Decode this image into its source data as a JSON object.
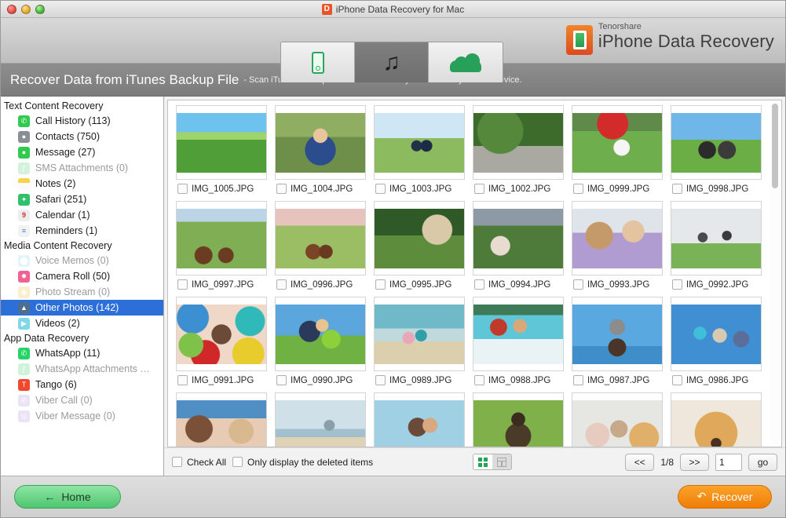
{
  "window": {
    "title": "iPhone Data Recovery for Mac",
    "logo_letter": "D",
    "controls": {
      "close": "close",
      "minimize": "minimize",
      "zoom": "zoom"
    }
  },
  "toolbar": {
    "tabs": [
      {
        "name": "recover-from-ios-device",
        "icon": "iphone-icon",
        "active": false
      },
      {
        "name": "recover-from-itunes-backup",
        "icon": "music-note-icon",
        "active": true
      },
      {
        "name": "recover-from-icloud-backup",
        "icon": "cloud-icon",
        "active": false
      }
    ],
    "brand": {
      "company": "Tenorshare",
      "product": "iPhone Data Recovery",
      "mark": "tenorshare-d-logo"
    }
  },
  "banner": {
    "title": "Recover Data from iTunes Backup File",
    "subtitle": "- Scan iTunes backup file to extract files if you have lost your iOS device."
  },
  "sidebar": {
    "groups": [
      {
        "title": "Text Content Recovery",
        "items": [
          {
            "label": "Call History (113)",
            "icon": "phone-icon",
            "color": "#31c94e",
            "dim": false,
            "selected": false
          },
          {
            "label": "Contacts (750)",
            "icon": "contacts-icon",
            "color": "#8a8f96",
            "dim": false,
            "selected": false
          },
          {
            "label": "Message (27)",
            "icon": "message-icon",
            "color": "#31c94e",
            "dim": false,
            "selected": false
          },
          {
            "label": "SMS Attachments (0)",
            "icon": "paperclip-icon",
            "color": "#9be0ac",
            "dim": true,
            "selected": false
          },
          {
            "label": "Notes (2)",
            "icon": "notes-icon",
            "color": "#f6d34b",
            "dim": false,
            "selected": false
          },
          {
            "label": "Safari (251)",
            "icon": "safari-icon",
            "color": "#2fc06a",
            "dim": false,
            "selected": false
          },
          {
            "label": "Calendar (1)",
            "icon": "calendar-icon",
            "color": "#ededed",
            "dim": false,
            "selected": false
          },
          {
            "label": "Reminders (1)",
            "icon": "reminders-icon",
            "color": "#f2f2f2",
            "dim": false,
            "selected": false
          }
        ]
      },
      {
        "title": "Media Content Recovery",
        "items": [
          {
            "label": "Voice Memos (0)",
            "icon": "microphone-icon",
            "color": "#bfe7f5",
            "dim": true,
            "selected": false
          },
          {
            "label": "Camera Roll (50)",
            "icon": "photos-icon",
            "color": "#f06292",
            "dim": false,
            "selected": false
          },
          {
            "label": "Photo Stream (0)",
            "icon": "photostream-icon",
            "color": "#f7d78a",
            "dim": true,
            "selected": false
          },
          {
            "label": "Other Photos (142)",
            "icon": "otherphotos-icon",
            "color": "#4e6e8e",
            "dim": false,
            "selected": true
          },
          {
            "label": "Videos (2)",
            "icon": "video-icon",
            "color": "#7fd8e8",
            "dim": false,
            "selected": false
          }
        ]
      },
      {
        "title": "App Data Recovery",
        "items": [
          {
            "label": "WhatsApp (11)",
            "icon": "whatsapp-icon",
            "color": "#25d366",
            "dim": false,
            "selected": false
          },
          {
            "label": "WhatsApp Attachments …",
            "icon": "whatsapp-attachment-icon",
            "color": "#8fe3a6",
            "dim": true,
            "selected": false
          },
          {
            "label": "Tango (6)",
            "icon": "tango-icon",
            "color": "#f0482c",
            "dim": false,
            "selected": false
          },
          {
            "label": "Viber Call (0)",
            "icon": "viber-call-icon",
            "color": "#cdbde8",
            "dim": true,
            "selected": false
          },
          {
            "label": "Viber Message (0)",
            "icon": "viber-message-icon",
            "color": "#cdbde8",
            "dim": true,
            "selected": false
          }
        ]
      }
    ]
  },
  "grid": {
    "photos": [
      {
        "filename": "IMG_1005.JPG",
        "checked": false,
        "alt": "green-field-landscape"
      },
      {
        "filename": "IMG_1004.JPG",
        "checked": false,
        "alt": "mother-with-two-boys"
      },
      {
        "filename": "IMG_1003.JPG",
        "checked": false,
        "alt": "two-boys-on-hill"
      },
      {
        "filename": "IMG_1002.JPG",
        "checked": false,
        "alt": "country-road-mailbox"
      },
      {
        "filename": "IMG_0999.JPG",
        "checked": false,
        "alt": "girl-with-calf-and-flowers"
      },
      {
        "filename": "IMG_0998.JPG",
        "checked": false,
        "alt": "two-cows-in-pasture"
      },
      {
        "filename": "IMG_0997.JPG",
        "checked": false,
        "alt": "horses-grazing-farm"
      },
      {
        "filename": "IMG_0996.JPG",
        "checked": false,
        "alt": "horses-pasture-sunset"
      },
      {
        "filename": "IMG_0995.JPG",
        "checked": false,
        "alt": "cottage-behind-fence"
      },
      {
        "filename": "IMG_0994.JPG",
        "checked": false,
        "alt": "woman-picking-strawberries"
      },
      {
        "filename": "IMG_0993.JPG",
        "checked": false,
        "alt": "boy-drawing-with-mother"
      },
      {
        "filename": "IMG_0992.JPG",
        "checked": false,
        "alt": "group-jumping-in-field"
      },
      {
        "filename": "IMG_0991.JPG",
        "checked": false,
        "alt": "kids-lying-in-circle"
      },
      {
        "filename": "IMG_0990.JPG",
        "checked": false,
        "alt": "family-sitting-on-grass"
      },
      {
        "filename": "IMG_0989.JPG",
        "checked": false,
        "alt": "family-walking-on-beach"
      },
      {
        "filename": "IMG_0988.JPG",
        "checked": false,
        "alt": "family-playing-in-sea"
      },
      {
        "filename": "IMG_0987.JPG",
        "checked": false,
        "alt": "father-lifting-child-sky"
      },
      {
        "filename": "IMG_0986.JPG",
        "checked": false,
        "alt": "kids-jumping-blue-sky"
      },
      {
        "filename": "",
        "checked": false,
        "alt": "three-people-smiling"
      },
      {
        "filename": "",
        "checked": false,
        "alt": "beach-with-pier"
      },
      {
        "filename": "",
        "checked": false,
        "alt": "mother-kissing-baby"
      },
      {
        "filename": "",
        "checked": false,
        "alt": "german-shepherd-dog"
      },
      {
        "filename": "",
        "checked": false,
        "alt": "family-with-golden-retriever"
      },
      {
        "filename": "",
        "checked": false,
        "alt": "golden-retriever-closeup"
      }
    ]
  },
  "bottombar": {
    "check_all_label": "Check All",
    "check_all_checked": false,
    "deleted_only_label": "Only display the deleted items",
    "deleted_only_checked": false,
    "view_grid": "grid-view",
    "view_list": "list-view",
    "prev_label": "<<",
    "next_label": ">>",
    "page_info": "1/8",
    "page_input_value": "1",
    "go_label": "go"
  },
  "footer": {
    "home_label": "Home",
    "home_icon": "arrow-left-icon",
    "recover_label": "Recover",
    "recover_icon": "undo-arrow-icon"
  },
  "colors": {
    "accent_green": "#4ec46f",
    "accent_orange": "#ef7d06",
    "selection_blue": "#2c6fd8",
    "banner_grey": "#858585"
  }
}
